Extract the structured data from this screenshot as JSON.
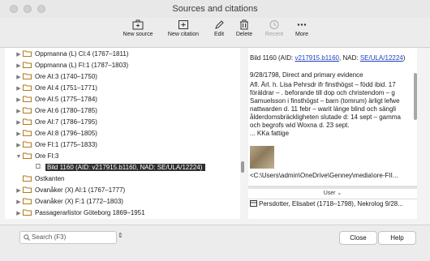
{
  "window": {
    "title": "Sources and citations"
  },
  "toolbar": {
    "new_source": "New source",
    "new_citation": "New citation",
    "edit": "Edit",
    "delete": "Delete",
    "recent": "Recent",
    "more": "More"
  },
  "tree": {
    "items": [
      {
        "label": "Oppmanna (L) CI:4 (1767–1811)"
      },
      {
        "label": "Oppmanna (L) FI:1 (1787–1803)"
      },
      {
        "label": "Ore AI:3 (1740–1750)"
      },
      {
        "label": "Ore AI:4 (1751–1771)"
      },
      {
        "label": "Ore AI:5 (1775–1784)"
      },
      {
        "label": "Ore AI:6 (1780–1785)"
      },
      {
        "label": "Ore AI:7 (1786–1795)"
      },
      {
        "label": "Ore AI:8 (1796–1805)"
      },
      {
        "label": "Ore FI:1 (1775–1833)"
      },
      {
        "label": "Ore FI:3"
      },
      {
        "label": "Bild 1160 (AID: v217915.b1160, NAD: SE/ULA/12224)"
      },
      {
        "label": "Ostkanten"
      },
      {
        "label": "Ovanåker (X) AI:1 (1767–1777)"
      },
      {
        "label": "Ovanåker (X) F:1 (1772–1803)"
      },
      {
        "label": "Passagerarlistor Göteborg 1869–1951"
      }
    ]
  },
  "detail": {
    "line1_prefix": "Bild 1160 (AID: ",
    "link1": "v217915.b1160",
    "line1_mid": ", NAD:",
    "link2_a": "SE/ULA/12224",
    "line2_suffix": ")",
    "line3": "9/28/1798, Direct and primary evidence",
    "line4": "Afl. Ärl. h. Lisa Pehrsdr ifr finsthögst – född ibid. 17",
    "line5": "föräldrar – . beforande till dop och christendom – g",
    "line6": "Samuelsson i finsthögst – barn (tomrum) ärligt lefwe",
    "line7": "nattwarden d. 11 febr – warit länge blind och sängli",
    "line8": "ålderdomsbräckligheten slutade d: 14 sept – gamma",
    "line9": "och begrofs wid Woxna d. 23 sept.",
    "line10": "... KKa fattige",
    "path": "<C:\\Users\\admin\\OneDrive\\Genney\\media\\ore-FII..."
  },
  "users": {
    "header": "User",
    "row": "Persdotter, Elisabet (1718–1798), Nekrolog 9/28..."
  },
  "bottom": {
    "search_placeholder": "Search (F3)",
    "close": "Close",
    "help": "Help"
  }
}
